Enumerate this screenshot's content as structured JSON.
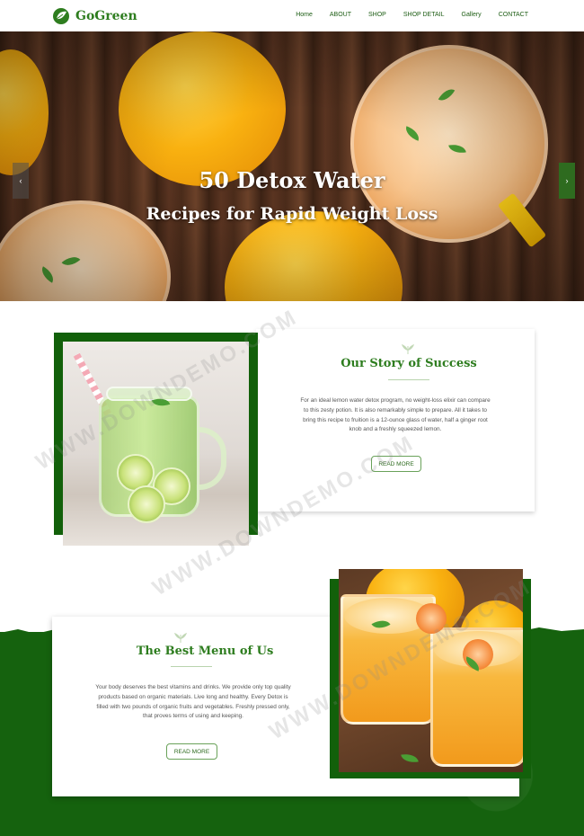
{
  "header": {
    "brand": "GoGreen",
    "nav": [
      "Home",
      "ABOUT",
      "SHOP",
      "SHOP DETAIL",
      "Gallery",
      "CONTACT"
    ]
  },
  "hero": {
    "title_line1": "50 Detox Water",
    "title_line2": "Recipes for Rapid Weight Loss",
    "prev_glyph": "‹",
    "next_glyph": "›"
  },
  "story": {
    "heading": "Our Story of Success",
    "text": "For an ideal lemon water detox program, no weight-loss elixir can compare to this zesty potion. It is also remarkably simple to prepare. All it takes to bring this recipe to fruition is a 12-ounce glass of water, half a ginger root knob and a freshly squeezed lemon.",
    "button": "READ MORE"
  },
  "menu": {
    "heading": "The Best Menu of Us",
    "text": "Your body deserves the best vitamins and drinks. We provide only top quality products based on organic materials. Live long and healthy. Every Detox is filled with two pounds of organic fruits and vegetables. Freshly pressed only, that proves terms of using and keeping.",
    "button": "READ MORE"
  },
  "watermark": "WWW.DOWNDEMO.COM",
  "colors": {
    "brand_green": "#2e7d1f",
    "dark_green": "#12600a",
    "band_green": "#15620e"
  }
}
